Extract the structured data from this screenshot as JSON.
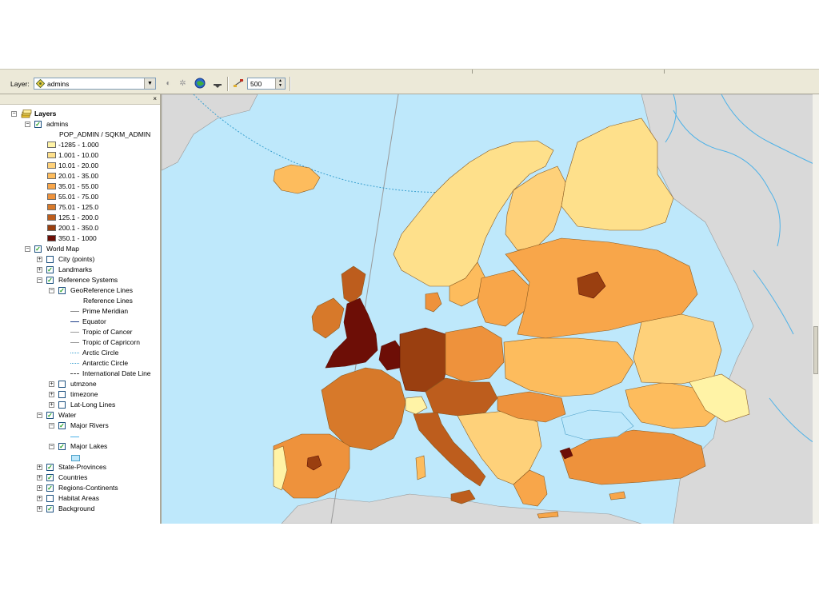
{
  "toolbar": {
    "layer_label": "Layer:",
    "layer_value": "admins",
    "scale_value": "500"
  },
  "icons": {
    "layer": "diamond-layer-icon",
    "contrast": "contrast-icon",
    "brightness": "brightness-icon",
    "transparency": "globe-icon",
    "effects": "effects-icon",
    "swipe": "swipe-icon"
  },
  "toc": {
    "close": "×",
    "root": "Layers",
    "admins": {
      "label": "admins",
      "field": "POP_ADMIN / SQKM_ADMIN",
      "classes": [
        {
          "label": "-1285 - 1.000",
          "color": "#fff3a6"
        },
        {
          "label": "1.001 - 10.00",
          "color": "#fee08b"
        },
        {
          "label": "10.01 - 20.00",
          "color": "#fed17a"
        },
        {
          "label": "20.01 - 35.00",
          "color": "#fdbc5d"
        },
        {
          "label": "35.01 - 55.00",
          "color": "#f8a64a"
        },
        {
          "label": "55.01 - 75.00",
          "color": "#ee923c"
        },
        {
          "label": "75.01 - 125.0",
          "color": "#d7792a"
        },
        {
          "label": "125.1 - 200.0",
          "color": "#bd5d1d"
        },
        {
          "label": "200.1 - 350.0",
          "color": "#9a3f10"
        },
        {
          "label": "350.1 - 1000",
          "color": "#6d0e06"
        }
      ]
    },
    "world_map": {
      "label": "World Map",
      "city": "City (points)",
      "landmarks": "Landmarks",
      "reference_systems": "Reference Systems",
      "georef": "GeoReference Lines",
      "reference_lines": "Reference Lines",
      "ref_items": [
        {
          "label": "Prime Meridian",
          "style": "solid",
          "color": "#8a8a8a"
        },
        {
          "label": "Equator",
          "style": "solid",
          "color": "#1f3f8a"
        },
        {
          "label": "Tropic of Cancer",
          "style": "solid",
          "color": "#9a9a9a"
        },
        {
          "label": "Tropic of Capricorn",
          "style": "solid",
          "color": "#9a9a9a"
        },
        {
          "label": "Arctic Circle",
          "style": "dotted",
          "color": "#3aa0d0"
        },
        {
          "label": "Antarctic Circle",
          "style": "dotted",
          "color": "#3aa0d0"
        },
        {
          "label": "International Date Line",
          "style": "dashdot",
          "color": "#444444"
        }
      ],
      "utmzone": "utmzone",
      "timezone": "timezone",
      "latlong": "Lat-Long Lines",
      "water": "Water",
      "major_rivers": "Major Rivers",
      "major_lakes": "Major Lakes",
      "state_provinces": "State-Provinces",
      "countries": "Countries",
      "regions": "Regions-Continents",
      "habitat": "Habitat Areas",
      "background": "Background"
    }
  },
  "map": {
    "water_color": "#bee8fb",
    "land_gray": "#d9d9d9",
    "river_color": "#4db2e8"
  }
}
